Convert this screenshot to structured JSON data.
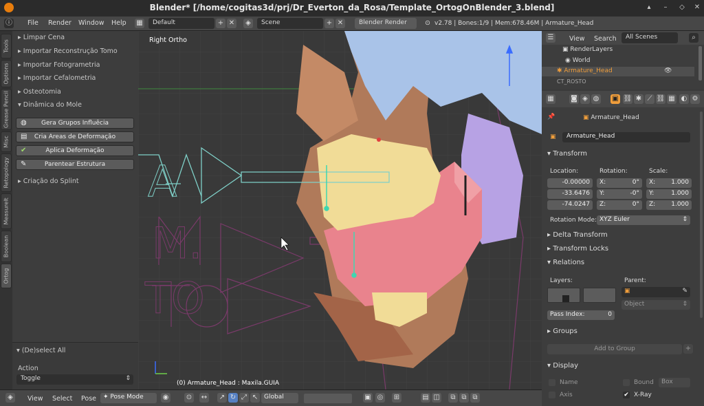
{
  "window": {
    "title": "Blender* [/home/cogitas3d/prj/Dr_Everton_da_Rosa/Template_OrtogOnBlender_3.blend]"
  },
  "topbar": {
    "menus": [
      "File",
      "Render",
      "Window",
      "Help"
    ],
    "layout": "Default",
    "scene": "Scene",
    "engine": "Blender Render",
    "stats": "v2.78 | Bones:1/9 | Mem:678.46M | Armature_Head"
  },
  "tabs": [
    "Tools",
    "Options",
    "Grease Pencil",
    "Misc",
    "Retopology",
    "Measurelt",
    "Boolean",
    "Ortog"
  ],
  "toolshelf": {
    "sections": [
      "Limpar Cena",
      "Importar Reconstrução Tomo",
      "Importar Fotogrametria",
      "Importar Cefalometria",
      "Osteotomia"
    ],
    "open_section": "Dinâmica do Mole",
    "buttons": [
      "Gera Grupos Influêcia",
      "Cria Areas de Deformação",
      "Aplica Deformação",
      "Parentear Estrutura"
    ],
    "after": "Criação do Splint",
    "operator": "(De)select All",
    "action_label": "Action",
    "action_value": "Toggle"
  },
  "viewport": {
    "view_name": "Right Ortho",
    "status": "(0) Armature_Head : Maxila.GUIA",
    "letters": [
      "A",
      "M.",
      "TO"
    ]
  },
  "bottombar": {
    "menus": [
      "View",
      "Select",
      "Pose"
    ],
    "mode": "Pose Mode",
    "orientation": "Global"
  },
  "outliner": {
    "menus": [
      "View",
      "Search"
    ],
    "filter": "All Scenes",
    "items": [
      "RenderLayers",
      "World",
      "Armature_Head",
      "CT_ROSTO"
    ]
  },
  "props": {
    "breadcrumb": "Armature_Head",
    "object_name": "Armature_Head",
    "transform": "Transform",
    "location_label": "Location:",
    "rotation_label": "Rotation:",
    "scale_label": "Scale:",
    "location": [
      "-0.00000",
      "-33.6476",
      "-74.0247"
    ],
    "rotation": [
      "0°",
      "-0°",
      "0°"
    ],
    "scale": [
      "1.000",
      "1.000",
      "1.000"
    ],
    "axes": [
      "X:",
      "Y:",
      "Z:"
    ],
    "rotation_mode_label": "Rotation Mode:",
    "rotation_mode": "XYZ Euler",
    "delta": "Delta Transform",
    "locks": "Transform Locks",
    "relations": "Relations",
    "layers_label": "Layers:",
    "parent_label": "Parent:",
    "parent_type": "Object",
    "pass_index_label": "Pass Index:",
    "pass_index": "0",
    "groups": "Groups",
    "add_to_group": "Add to Group",
    "display": "Display",
    "name_label": "Name",
    "bound_label": "Bound",
    "bound_value": "Box",
    "axis_label": "Axis",
    "xray_label": "X-Ray"
  },
  "colors": {
    "accent": "#f09e3c",
    "selected": "#ff8c00",
    "header": "#474747"
  }
}
